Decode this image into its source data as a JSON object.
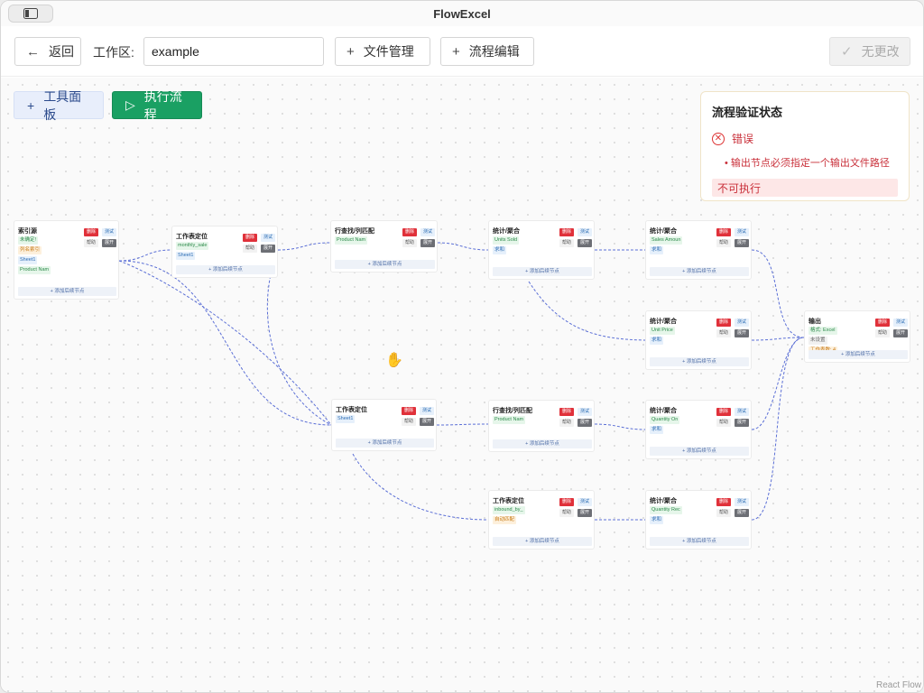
{
  "app": {
    "title": "FlowExcel"
  },
  "toolbar": {
    "back_label": "返回",
    "workspace_label": "工作区:",
    "workspace_value": "example",
    "file_mgmt_label": "文件管理",
    "flow_edit_label": "流程编辑",
    "no_changes_label": "无更改"
  },
  "canvas_toolbar": {
    "tools_label": "工具面板",
    "run_label": "执行流程"
  },
  "validation": {
    "title": "流程验证状态",
    "status": "错误",
    "message": "输出节点必须指定一个输出文件路径",
    "badge": "不可执行"
  },
  "common": {
    "del": "删除",
    "test": "测试",
    "help": "帮助",
    "expand": "展开",
    "add_next": "+ 添加后续节点"
  },
  "nodes": [
    {
      "id": "n1",
      "title": "索引源",
      "tags": [
        [
          "未确定!",
          "green"
        ],
        [
          "列名索引",
          "orange"
        ],
        [
          "Sheet1",
          "blue"
        ],
        [
          "Product Nam",
          "green"
        ]
      ]
    },
    {
      "id": "n2",
      "title": "工作表定位",
      "tags": [
        [
          "monthly_sale",
          "green"
        ],
        [
          "Sheet1",
          "blue"
        ]
      ]
    },
    {
      "id": "n3",
      "title": "行查找/列匹配",
      "tags": [
        [
          "Product Nam",
          "green"
        ]
      ]
    },
    {
      "id": "n4",
      "title": "统计/聚合",
      "tags": [
        [
          "Units Sold",
          "green"
        ],
        [
          "求和",
          "blue"
        ]
      ]
    },
    {
      "id": "n5",
      "title": "统计/聚合",
      "tags": [
        [
          "Sales Amoun",
          "green"
        ],
        [
          "求和",
          "blue"
        ]
      ]
    },
    {
      "id": "n6",
      "title": "统计/聚合",
      "tags": [
        [
          "Unit Price",
          "green"
        ],
        [
          "求和",
          "blue"
        ]
      ]
    },
    {
      "id": "n7",
      "title": "输出",
      "tags": [
        [
          "格式: Excel",
          "green"
        ],
        [
          "未设置",
          "gray"
        ],
        [
          "工作表数: 4",
          "orange"
        ]
      ]
    },
    {
      "id": "n8",
      "title": "工作表定位",
      "tags": [
        [
          "Sheet1",
          "blue"
        ]
      ]
    },
    {
      "id": "n9",
      "title": "行查找/列匹配",
      "tags": [
        [
          "Product Nam",
          "green"
        ]
      ]
    },
    {
      "id": "n10",
      "title": "统计/聚合",
      "tags": [
        [
          "Quantity On",
          "green"
        ],
        [
          "求和",
          "blue"
        ]
      ]
    },
    {
      "id": "n11",
      "title": "工作表定位",
      "tags": [
        [
          "inbound_by_",
          "green"
        ],
        [
          "自动匹配",
          "orange"
        ]
      ]
    },
    {
      "id": "n12",
      "title": "统计/聚合",
      "tags": [
        [
          "Quantity Rec",
          "green"
        ],
        [
          "求和",
          "blue"
        ]
      ]
    }
  ],
  "footer": {
    "attribution": "React Flow"
  },
  "colors": {
    "accent": "#1aa063",
    "edge": "#5b6fd6",
    "error": "#c9303a"
  }
}
